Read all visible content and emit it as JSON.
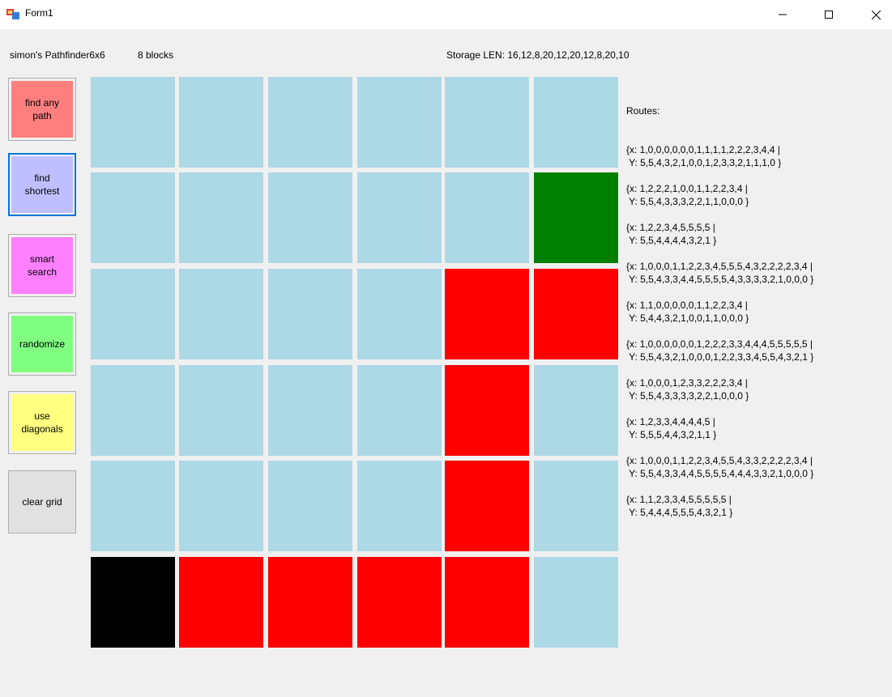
{
  "window": {
    "title": "Form1",
    "minimize_icon": "minimize-icon",
    "maximize_icon": "maximize-icon",
    "close_icon": "close-icon"
  },
  "header": {
    "app_name": "simon's Pathfinder6x6",
    "blocks": "8 blocks",
    "storage": "Storage LEN: 16,12,8,20,12,20,12,8,20,10"
  },
  "buttons": {
    "find_any": "find any path",
    "find_shortest": "find shortest",
    "smart_search": "smart search",
    "randomize": "randomize",
    "use_diagonals": "use diagonals",
    "clear_grid": "clear grid"
  },
  "colors": {
    "empty": "#add8e6",
    "goal": "#008000",
    "block": "#ff0000",
    "start": "#000000"
  },
  "grid": [
    [
      "empty",
      "empty",
      "empty",
      "empty",
      "empty",
      "empty"
    ],
    [
      "empty",
      "empty",
      "empty",
      "empty",
      "empty",
      "goal"
    ],
    [
      "empty",
      "empty",
      "empty",
      "empty",
      "block",
      "block"
    ],
    [
      "empty",
      "empty",
      "empty",
      "empty",
      "block",
      "empty"
    ],
    [
      "empty",
      "empty",
      "empty",
      "empty",
      "block",
      "empty"
    ],
    [
      "start",
      "block",
      "block",
      "block",
      "block",
      "empty"
    ]
  ],
  "routes_heading": "Routes:",
  "routes": [
    "{x: 1,0,0,0,0,0,0,1,1,1,1,2,2,2,3,4,4 |\n Y: 5,5,4,3,2,1,0,0,1,2,3,3,2,1,1,1,0 }",
    "{x: 1,2,2,2,1,0,0,1,1,2,2,3,4 |\n Y: 5,5,4,3,3,3,2,2,1,1,0,0,0 }",
    "{x: 1,2,2,3,4,5,5,5,5 |\n Y: 5,5,4,4,4,4,3,2,1 }",
    "{x: 1,0,0,0,1,1,2,2,3,4,5,5,5,4,3,2,2,2,2,3,4 |\n Y: 5,5,4,3,3,4,4,5,5,5,5,4,3,3,3,3,2,1,0,0,0 }",
    "{x: 1,1,0,0,0,0,0,1,1,2,2,3,4 |\n Y: 5,4,4,3,2,1,0,0,1,1,0,0,0 }",
    "{x: 1,0,0,0,0,0,0,1,2,2,2,3,3,4,4,4,5,5,5,5,5 |\n Y: 5,5,4,3,2,1,0,0,0,1,2,2,3,3,4,5,5,4,3,2,1 }",
    "{x: 1,0,0,0,1,2,3,3,2,2,2,3,4 |\n Y: 5,5,4,3,3,3,3,2,2,1,0,0,0 }",
    "{x: 1,2,3,3,4,4,4,4,5 |\n Y: 5,5,5,4,4,3,2,1,1 }",
    "{x: 1,0,0,0,1,1,2,2,3,4,5,5,4,3,3,2,2,2,2,3,4 |\n Y: 5,5,4,3,3,4,4,5,5,5,5,4,4,4,3,3,2,1,0,0,0 }",
    "{x: 1,1,2,3,3,4,5,5,5,5,5 |\n Y: 5,4,4,4,5,5,5,4,3,2,1 }"
  ]
}
